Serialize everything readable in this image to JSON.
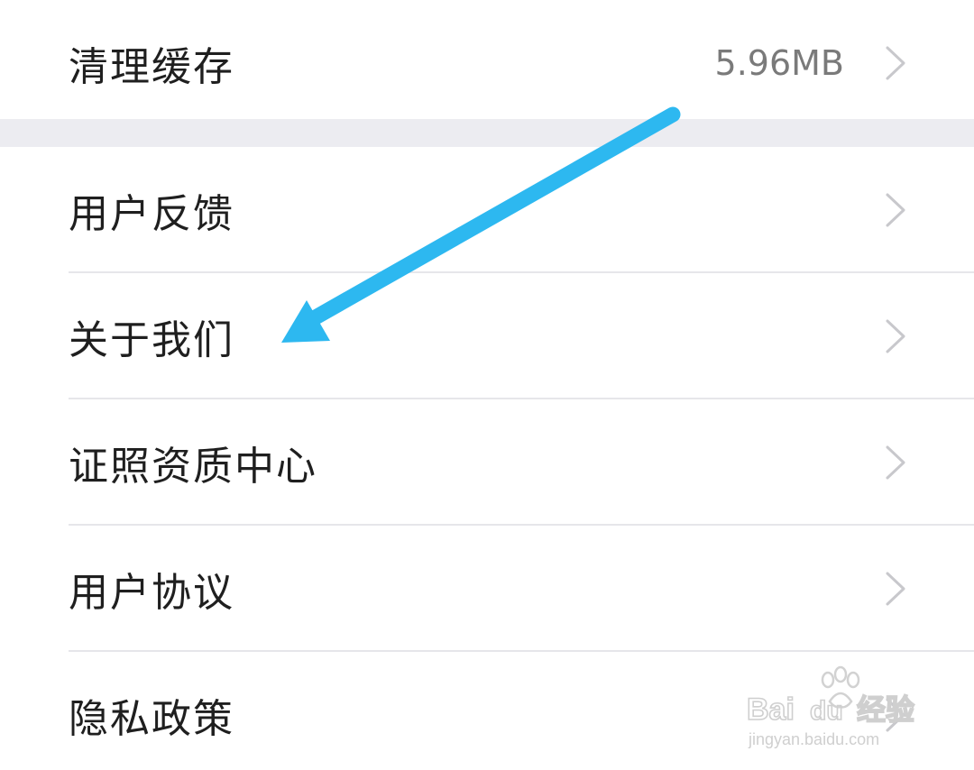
{
  "settings": {
    "cache": {
      "label": "清理缓存",
      "value": "5.96MB"
    },
    "items": [
      {
        "label": "用户反馈"
      },
      {
        "label": "关于我们"
      },
      {
        "label": "证照资质中心"
      },
      {
        "label": "用户协议"
      },
      {
        "label": "隐私政策"
      }
    ]
  },
  "colors": {
    "annotation_arrow": "#2db8f0",
    "section_gap": "#ececf1"
  },
  "watermark": {
    "brand": "Bai du 经验",
    "url": "jingyan.baidu.com"
  }
}
